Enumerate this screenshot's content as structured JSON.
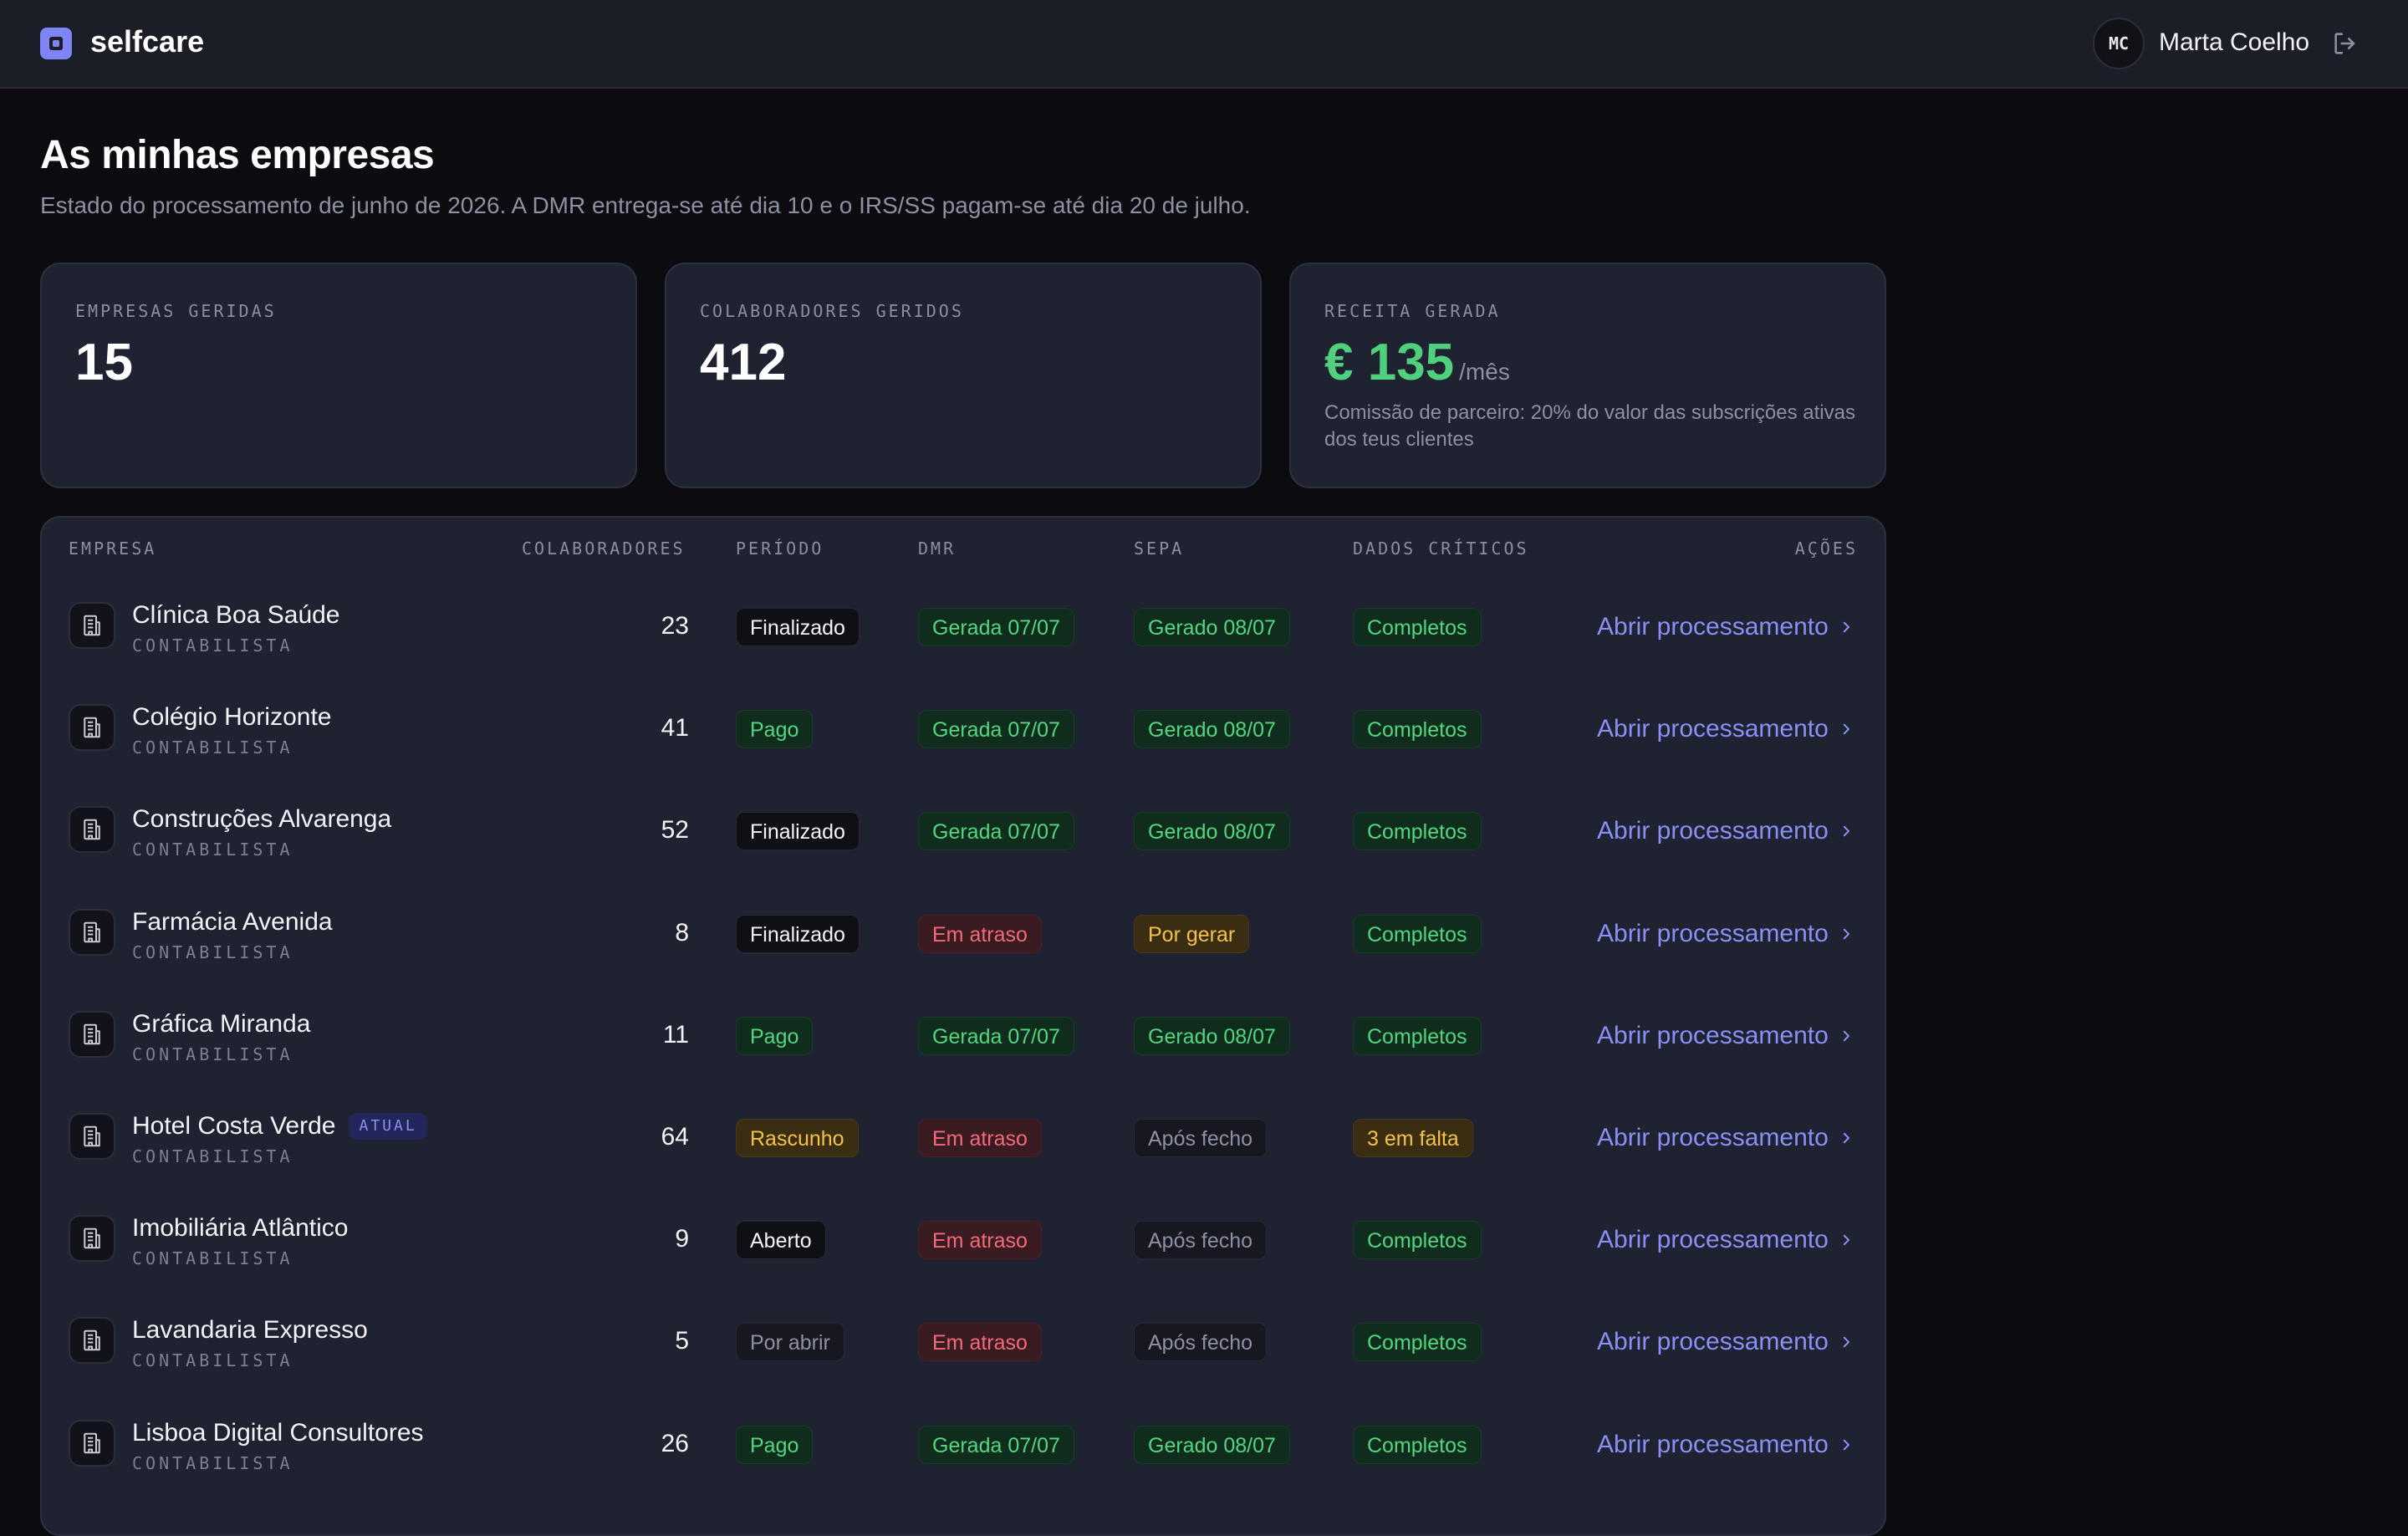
{
  "app": {
    "name": "selfcare",
    "user_initials": "MC",
    "user_name": "Marta Coelho",
    "logo_icon": "square-logo-icon",
    "logout_icon": "logout-icon"
  },
  "page": {
    "title": "As minhas empresas",
    "subtitle": "Estado do processamento de junho de 2026. A DMR entrega-se até dia 10 e o IRS/SS pagam-se até dia 20 de julho."
  },
  "stats": [
    {
      "label": "EMPRESAS GERIDAS",
      "value": "15"
    },
    {
      "label": "COLABORADORES GERIDOS",
      "value": "412"
    },
    {
      "label": "RECEITA GERADA",
      "value": "€ 135",
      "unit": "/mês",
      "note": "Comissão de parceiro: 20% do valor das subscrições ativas dos teus clientes"
    }
  ],
  "colors": {
    "accent": "#8a8ff5",
    "green": "#52d67f",
    "red": "#f26a7a",
    "yellow": "#f3c24a"
  },
  "table": {
    "headers": {
      "empresa": "EMPRESA",
      "colaboradores": "COLABORADORES",
      "periodo": "PERÍODO",
      "dmr": "DMR",
      "sepa": "SEPA",
      "dados": "DADOS CRÍTICOS",
      "acoes": "AÇÕES"
    },
    "row_icon": "building-icon",
    "action_label": "Abrir processamento",
    "rows": [
      {
        "name": "Clínica Boa Saúde",
        "role": "CONTABILISTA",
        "colaboradores": "23",
        "periodo": "Finalizado",
        "periodo_status": "dark",
        "dmr": "Gerada 07/07",
        "dmr_status": "green",
        "sepa": "Gerado 08/07",
        "sepa_status": "green",
        "dados": "Completos",
        "dados_status": "green"
      },
      {
        "name": "Colégio Horizonte",
        "role": "CONTABILISTA",
        "colaboradores": "41",
        "periodo": "Pago",
        "periodo_status": "green",
        "dmr": "Gerada 07/07",
        "dmr_status": "green",
        "sepa": "Gerado 08/07",
        "sepa_status": "green",
        "dados": "Completos",
        "dados_status": "green"
      },
      {
        "name": "Construções Alvarenga",
        "role": "CONTABILISTA",
        "colaboradores": "52",
        "periodo": "Finalizado",
        "periodo_status": "dark",
        "dmr": "Gerada 07/07",
        "dmr_status": "green",
        "sepa": "Gerado 08/07",
        "sepa_status": "green",
        "dados": "Completos",
        "dados_status": "green"
      },
      {
        "name": "Farmácia Avenida",
        "role": "CONTABILISTA",
        "colaboradores": "8",
        "periodo": "Finalizado",
        "periodo_status": "dark",
        "dmr": "Em atraso",
        "dmr_status": "red",
        "sepa": "Por gerar",
        "sepa_status": "yellow",
        "dados": "Completos",
        "dados_status": "green"
      },
      {
        "name": "Gráfica Miranda",
        "role": "CONTABILISTA",
        "colaboradores": "11",
        "periodo": "Pago",
        "periodo_status": "green",
        "dmr": "Gerada 07/07",
        "dmr_status": "green",
        "sepa": "Gerado 08/07",
        "sepa_status": "green",
        "dados": "Completos",
        "dados_status": "green"
      },
      {
        "name": "Hotel Costa Verde",
        "badge": "ATUAL",
        "role": "CONTABILISTA",
        "colaboradores": "64",
        "periodo": "Rascunho",
        "periodo_status": "yellow",
        "dmr": "Em atraso",
        "dmr_status": "red",
        "sepa": "Após fecho",
        "sepa_status": "grey",
        "dados": "3 em falta",
        "dados_status": "yellow"
      },
      {
        "name": "Imobiliária Atlântico",
        "role": "CONTABILISTA",
        "colaboradores": "9",
        "periodo": "Aberto",
        "periodo_status": "dark",
        "dmr": "Em atraso",
        "dmr_status": "red",
        "sepa": "Após fecho",
        "sepa_status": "grey",
        "dados": "Completos",
        "dados_status": "green"
      },
      {
        "name": "Lavandaria Expresso",
        "role": "CONTABILISTA",
        "colaboradores": "5",
        "periodo": "Por abrir",
        "periodo_status": "grey",
        "dmr": "Em atraso",
        "dmr_status": "red",
        "sepa": "Após fecho",
        "sepa_status": "grey",
        "dados": "Completos",
        "dados_status": "green"
      },
      {
        "name": "Lisboa Digital Consultores",
        "role": "CONTABILISTA",
        "colaboradores": "26",
        "periodo": "Pago",
        "periodo_status": "green",
        "dmr": "Gerada 07/07",
        "dmr_status": "green",
        "sepa": "Gerado 08/07",
        "sepa_status": "green",
        "dados": "Completos",
        "dados_status": "green"
      }
    ]
  }
}
